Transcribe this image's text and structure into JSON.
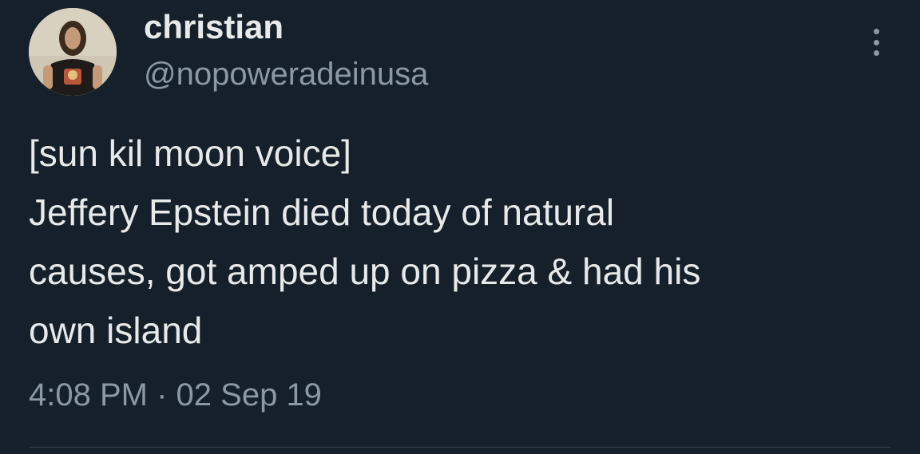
{
  "author": {
    "display_name": "christian",
    "handle": "@nopoweradeinusa"
  },
  "tweet": {
    "lines": [
      "[sun kil moon voice]",
      "Jeffery Epstein died today of natural",
      "causes, got amped up on pizza & had his",
      "own island"
    ],
    "time": "4:08 PM",
    "separator": "·",
    "date": "02 Sep 19"
  },
  "icons": {
    "more": "more-vertical-icon"
  },
  "colors": {
    "background": "#15202b",
    "primary_text": "#e7e9ea",
    "secondary_text": "#8b98a5"
  }
}
